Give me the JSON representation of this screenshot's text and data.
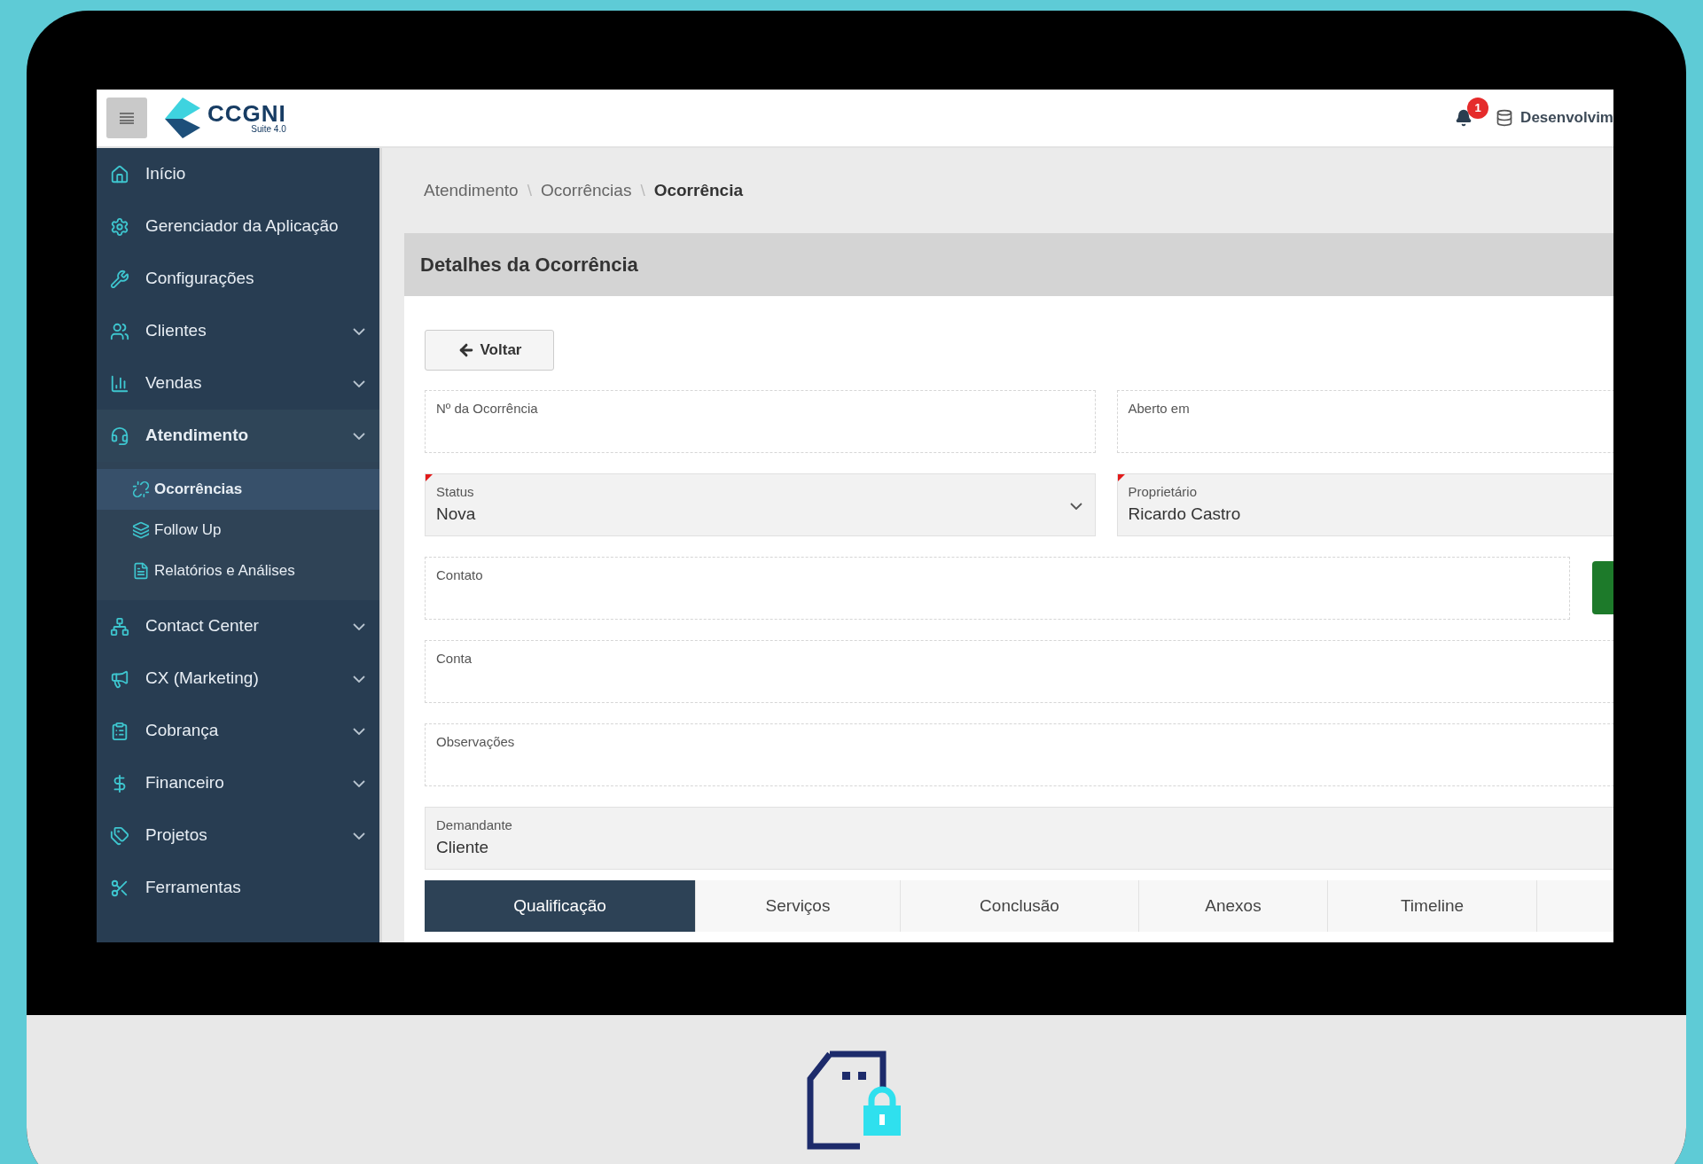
{
  "header": {
    "logo": {
      "name": "CCGNI",
      "tagline": "Suite 4.0"
    },
    "notification_count": "1",
    "environment": "Desenvolvim"
  },
  "sidebar": {
    "items": [
      {
        "label": "Início",
        "kind": "link",
        "selected": false
      },
      {
        "label": "Gerenciador da Aplicação",
        "kind": "link",
        "selected": false
      },
      {
        "label": "Configurações",
        "kind": "link",
        "selected": false
      },
      {
        "label": "Clientes",
        "kind": "group",
        "selected": false
      },
      {
        "label": "Vendas",
        "kind": "group",
        "selected": false
      },
      {
        "label": "Atendimento",
        "kind": "group",
        "selected": true,
        "children": [
          {
            "label": "Ocorrências",
            "selected": true
          },
          {
            "label": "Follow Up",
            "selected": false
          },
          {
            "label": "Relatórios e Análises",
            "selected": false
          }
        ]
      },
      {
        "label": "Contact Center",
        "kind": "group",
        "selected": false
      },
      {
        "label": "CX (Marketing)",
        "kind": "group",
        "selected": false
      },
      {
        "label": "Cobrança",
        "kind": "group",
        "selected": false
      },
      {
        "label": "Financeiro",
        "kind": "group",
        "selected": false
      },
      {
        "label": "Projetos",
        "kind": "group",
        "selected": false
      },
      {
        "label": "Ferramentas",
        "kind": "link",
        "selected": false
      }
    ]
  },
  "breadcrumb": {
    "separator": "\\",
    "items": [
      "Atendimento",
      "Ocorrências",
      "Ocorrência"
    ]
  },
  "card": {
    "title": "Detalhes da Ocorrência",
    "back_button": "Voltar",
    "rows": [
      [
        {
          "label": "Nº da Ocorrência",
          "kind": "input",
          "required": false
        },
        {
          "label": "Aberto em",
          "kind": "input",
          "required": false
        }
      ],
      [
        {
          "label": "Status",
          "kind": "select",
          "value": "Nova",
          "required": true
        },
        {
          "label": "Proprietário",
          "kind": "readonly",
          "value": "Ricardo Castro",
          "required": true
        }
      ],
      [
        {
          "label": "Contato",
          "kind": "input",
          "required": false,
          "has_action": true
        }
      ],
      [
        {
          "label": "Conta",
          "kind": "input",
          "required": false
        }
      ],
      [
        {
          "label": "Observações",
          "kind": "input",
          "required": false
        }
      ],
      [
        {
          "label": "Demandante",
          "kind": "readonly",
          "value": "Cliente",
          "required": false
        }
      ]
    ],
    "tabs": [
      {
        "label": "Qualificação",
        "selected": true
      },
      {
        "label": "Serviços",
        "selected": false
      },
      {
        "label": "Conclusão",
        "selected": false
      },
      {
        "label": "Anexos",
        "selected": false
      },
      {
        "label": "Timeline",
        "selected": false
      }
    ]
  }
}
